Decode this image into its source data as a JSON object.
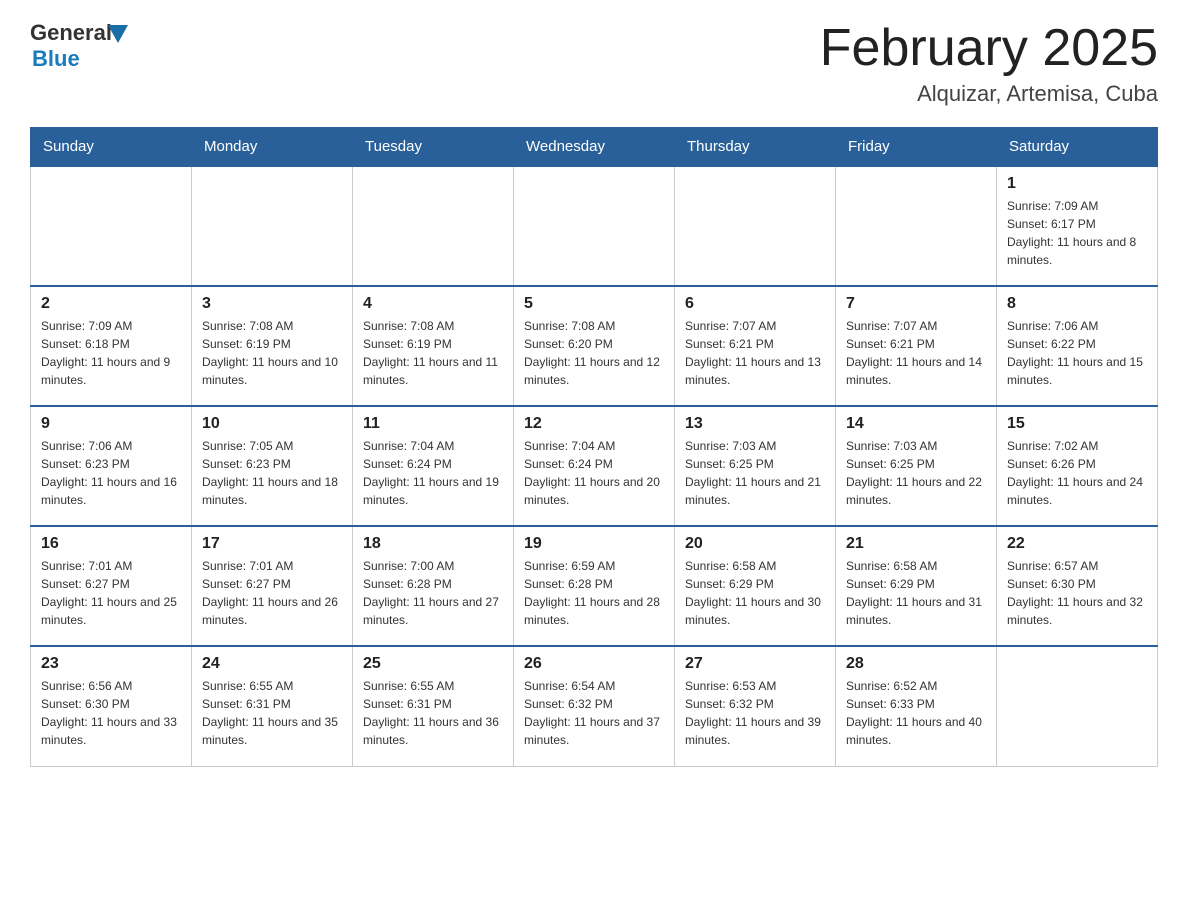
{
  "header": {
    "logo": {
      "general": "General",
      "blue": "Blue",
      "triangle_color": "#1a6ea8"
    },
    "title": "February 2025",
    "subtitle": "Alquizar, Artemisa, Cuba"
  },
  "weekdays": [
    "Sunday",
    "Monday",
    "Tuesday",
    "Wednesday",
    "Thursday",
    "Friday",
    "Saturday"
  ],
  "weeks": [
    [
      {
        "day": "",
        "info": ""
      },
      {
        "day": "",
        "info": ""
      },
      {
        "day": "",
        "info": ""
      },
      {
        "day": "",
        "info": ""
      },
      {
        "day": "",
        "info": ""
      },
      {
        "day": "",
        "info": ""
      },
      {
        "day": "1",
        "info": "Sunrise: 7:09 AM\nSunset: 6:17 PM\nDaylight: 11 hours and 8 minutes."
      }
    ],
    [
      {
        "day": "2",
        "info": "Sunrise: 7:09 AM\nSunset: 6:18 PM\nDaylight: 11 hours and 9 minutes."
      },
      {
        "day": "3",
        "info": "Sunrise: 7:08 AM\nSunset: 6:19 PM\nDaylight: 11 hours and 10 minutes."
      },
      {
        "day": "4",
        "info": "Sunrise: 7:08 AM\nSunset: 6:19 PM\nDaylight: 11 hours and 11 minutes."
      },
      {
        "day": "5",
        "info": "Sunrise: 7:08 AM\nSunset: 6:20 PM\nDaylight: 11 hours and 12 minutes."
      },
      {
        "day": "6",
        "info": "Sunrise: 7:07 AM\nSunset: 6:21 PM\nDaylight: 11 hours and 13 minutes."
      },
      {
        "day": "7",
        "info": "Sunrise: 7:07 AM\nSunset: 6:21 PM\nDaylight: 11 hours and 14 minutes."
      },
      {
        "day": "8",
        "info": "Sunrise: 7:06 AM\nSunset: 6:22 PM\nDaylight: 11 hours and 15 minutes."
      }
    ],
    [
      {
        "day": "9",
        "info": "Sunrise: 7:06 AM\nSunset: 6:23 PM\nDaylight: 11 hours and 16 minutes."
      },
      {
        "day": "10",
        "info": "Sunrise: 7:05 AM\nSunset: 6:23 PM\nDaylight: 11 hours and 18 minutes."
      },
      {
        "day": "11",
        "info": "Sunrise: 7:04 AM\nSunset: 6:24 PM\nDaylight: 11 hours and 19 minutes."
      },
      {
        "day": "12",
        "info": "Sunrise: 7:04 AM\nSunset: 6:24 PM\nDaylight: 11 hours and 20 minutes."
      },
      {
        "day": "13",
        "info": "Sunrise: 7:03 AM\nSunset: 6:25 PM\nDaylight: 11 hours and 21 minutes."
      },
      {
        "day": "14",
        "info": "Sunrise: 7:03 AM\nSunset: 6:25 PM\nDaylight: 11 hours and 22 minutes."
      },
      {
        "day": "15",
        "info": "Sunrise: 7:02 AM\nSunset: 6:26 PM\nDaylight: 11 hours and 24 minutes."
      }
    ],
    [
      {
        "day": "16",
        "info": "Sunrise: 7:01 AM\nSunset: 6:27 PM\nDaylight: 11 hours and 25 minutes."
      },
      {
        "day": "17",
        "info": "Sunrise: 7:01 AM\nSunset: 6:27 PM\nDaylight: 11 hours and 26 minutes."
      },
      {
        "day": "18",
        "info": "Sunrise: 7:00 AM\nSunset: 6:28 PM\nDaylight: 11 hours and 27 minutes."
      },
      {
        "day": "19",
        "info": "Sunrise: 6:59 AM\nSunset: 6:28 PM\nDaylight: 11 hours and 28 minutes."
      },
      {
        "day": "20",
        "info": "Sunrise: 6:58 AM\nSunset: 6:29 PM\nDaylight: 11 hours and 30 minutes."
      },
      {
        "day": "21",
        "info": "Sunrise: 6:58 AM\nSunset: 6:29 PM\nDaylight: 11 hours and 31 minutes."
      },
      {
        "day": "22",
        "info": "Sunrise: 6:57 AM\nSunset: 6:30 PM\nDaylight: 11 hours and 32 minutes."
      }
    ],
    [
      {
        "day": "23",
        "info": "Sunrise: 6:56 AM\nSunset: 6:30 PM\nDaylight: 11 hours and 33 minutes."
      },
      {
        "day": "24",
        "info": "Sunrise: 6:55 AM\nSunset: 6:31 PM\nDaylight: 11 hours and 35 minutes."
      },
      {
        "day": "25",
        "info": "Sunrise: 6:55 AM\nSunset: 6:31 PM\nDaylight: 11 hours and 36 minutes."
      },
      {
        "day": "26",
        "info": "Sunrise: 6:54 AM\nSunset: 6:32 PM\nDaylight: 11 hours and 37 minutes."
      },
      {
        "day": "27",
        "info": "Sunrise: 6:53 AM\nSunset: 6:32 PM\nDaylight: 11 hours and 39 minutes."
      },
      {
        "day": "28",
        "info": "Sunrise: 6:52 AM\nSunset: 6:33 PM\nDaylight: 11 hours and 40 minutes."
      },
      {
        "day": "",
        "info": ""
      }
    ]
  ]
}
